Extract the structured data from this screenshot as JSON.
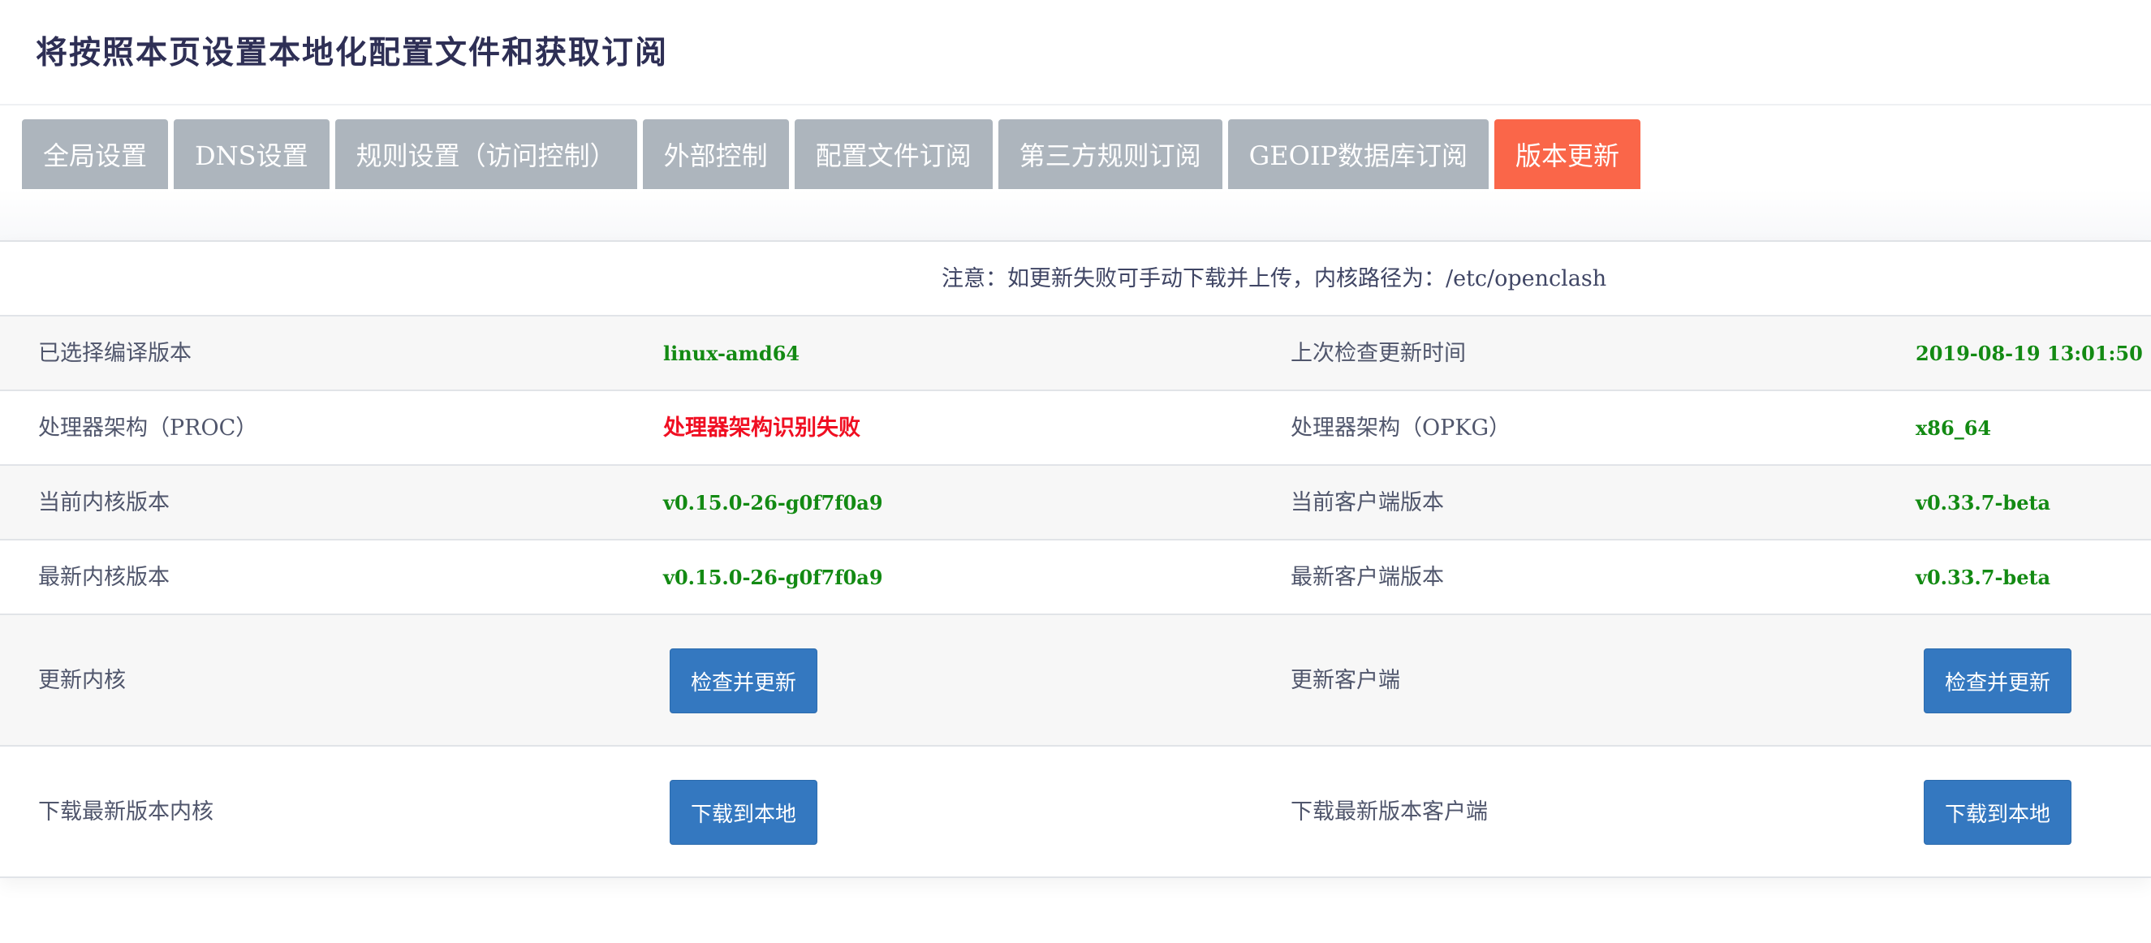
{
  "header": {
    "title": "将按照本页设置本地化配置文件和获取订阅"
  },
  "tabs": [
    {
      "label": "全局设置"
    },
    {
      "label": "DNS设置"
    },
    {
      "label": "规则设置（访问控制）"
    },
    {
      "label": "外部控制"
    },
    {
      "label": "配置文件订阅"
    },
    {
      "label": "第三方规则订阅"
    },
    {
      "label": "GEOIP数据库订阅"
    },
    {
      "label": "版本更新",
      "active": true
    }
  ],
  "notice": "注意：如更新失败可手动下载并上传，内核路径为：/etc/openclash",
  "info_rows": [
    {
      "left_label": "已选择编译版本",
      "left_value": "linux-amd64",
      "right_label": "上次检查更新时间",
      "right_value": "2019-08-19 13:01:50"
    },
    {
      "left_label": "处理器架构（PROC）",
      "left_value": "处理器架构识别失败",
      "right_label": "处理器架构（OPKG）",
      "right_value": "x86_64"
    },
    {
      "left_label": "当前内核版本",
      "left_value": "v0.15.0-26-g0f7f0a9",
      "right_label": "当前客户端版本",
      "right_value": "v0.33.7-beta"
    },
    {
      "left_label": "最新内核版本",
      "left_value": "v0.15.0-26-g0f7f0a9",
      "right_label": "最新客户端版本",
      "right_value": "v0.33.7-beta"
    }
  ],
  "action_rows": [
    {
      "left_label": "更新内核",
      "left_button": "检查并更新",
      "right_label": "更新客户端",
      "right_button": "检查并更新"
    },
    {
      "left_label": "下载最新版本内核",
      "left_button": "下载到本地",
      "right_label": "下载最新版本客户端",
      "right_button": "下载到本地"
    }
  ],
  "colors": {
    "tab_inactive": "#adb5bd",
    "tab_active": "#fa6649",
    "button": "#3478c0",
    "value_ok": "#138a13",
    "value_error": "#f00f22"
  }
}
